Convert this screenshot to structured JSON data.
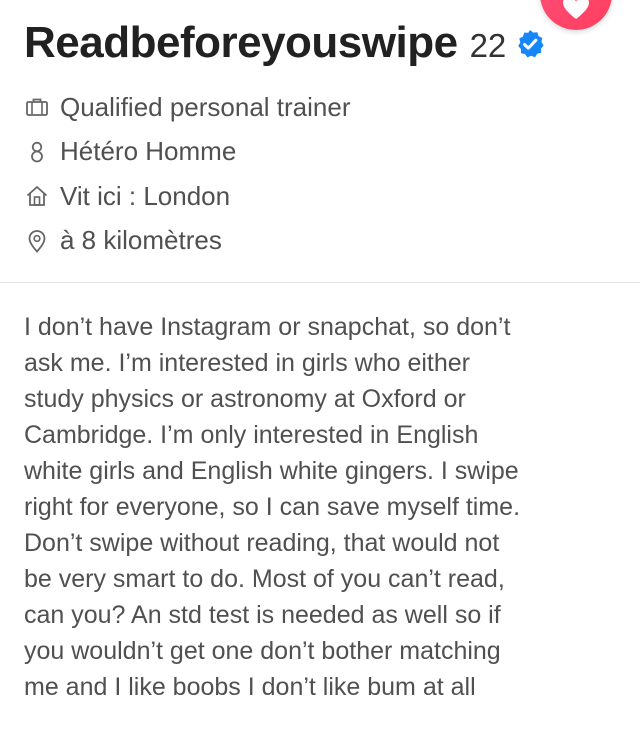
{
  "profile": {
    "name": "Readbeforeyouswipe",
    "age": "22",
    "verified_icon": "verified-badge-icon",
    "accent_color": "#1786f8"
  },
  "like_button": {
    "icon": "heart-icon",
    "color": "#ff4458"
  },
  "info": [
    {
      "icon": "briefcase-icon",
      "text": "Qualified personal trainer"
    },
    {
      "icon": "gender-icon",
      "text": "Hétéro Homme"
    },
    {
      "icon": "home-icon",
      "text": "Vit ici : London"
    },
    {
      "icon": "location-pin-icon",
      "text": "à 8 kilomètres"
    }
  ],
  "bio": [
    "I don’t have Instagram or snapchat, so don’t",
    "ask me. I’m interested in girls who either",
    "study physics or astronomy at Oxford or",
    "Cambridge. I’m only interested in English",
    "white girls and English white gingers. I swipe",
    "right for everyone, so I can save myself time.",
    "Don’t swipe without reading, that would not",
    "be very smart to do. Most of you can’t read,",
    "can you? An std test is needed as well so if",
    "you wouldn’t get one don’t bother matching",
    "me and I like boobs I don’t like bum at all"
  ]
}
